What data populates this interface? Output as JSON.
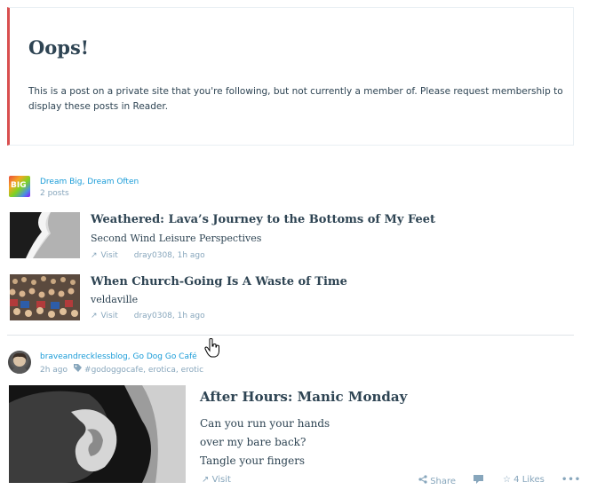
{
  "notice": {
    "title": "Oops!",
    "body": "This is a post on a private site that you're following, but not currently a member of. Please request membership to display these posts in Reader."
  },
  "site_card": {
    "avatar_text": "BIG",
    "site_name": "Dream Big, Dream Often",
    "post_count": "2 posts",
    "posts": [
      {
        "title": "Weathered: Lava’s Journey to the Bottoms of My Feet",
        "site": "Second Wind Leisure Perspectives",
        "visit_label": "Visit",
        "byline": "dray0308, 1h ago"
      },
      {
        "title": "When Church-Going Is A Waste of Time",
        "site": "veldaville",
        "visit_label": "Visit",
        "byline": "dray0308, 1h ago"
      }
    ]
  },
  "post_card": {
    "author": "braveandrecklessblog, Go Dog Go Café",
    "time": "2h ago",
    "tags": "#godoggocafe, erotica, erotic",
    "title": "After Hours: Manic Monday",
    "excerpt": [
      "Can you run your hands",
      "over my bare back?",
      "Tangle your fingers"
    ],
    "visit_label": "Visit",
    "share_label": "Share",
    "likes_label": "4 Likes",
    "more_label": "•••"
  },
  "icons": {
    "external": "↗",
    "share": "share-icon",
    "comment": "comment-icon",
    "star": "☆",
    "tag": "tag-icon"
  }
}
